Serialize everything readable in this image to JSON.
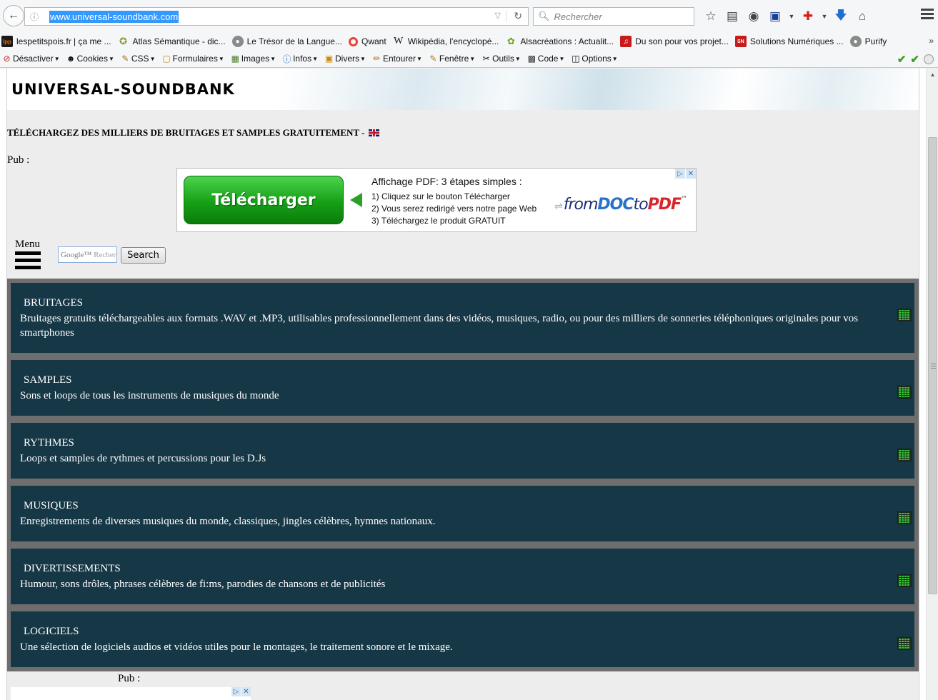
{
  "browser": {
    "url": "www.universal-soundbank.com",
    "search_placeholder": "Rechercher"
  },
  "bookmarks": [
    {
      "label": "lespetitspois.fr | ça me ...",
      "icon": "lpp-icon",
      "color": "#e36b00"
    },
    {
      "label": "Atlas Sémantique - dic...",
      "icon": "atlas-icon",
      "color": "#7a9a2a"
    },
    {
      "label": "Le Trésor de la Langue...",
      "icon": "globe-icon",
      "color": "#8a8a8a"
    },
    {
      "label": "Qwant",
      "icon": "qwant-icon",
      "color": "#e8433a"
    },
    {
      "label": "Wikipédia, l'encyclopé...",
      "icon": "wikipedia-icon",
      "color": "#ffffff"
    },
    {
      "label": "Alsacréations : Actualit...",
      "icon": "alsacreations-icon",
      "color": "#6ba51d"
    },
    {
      "label": "Du son pour vos projet...",
      "icon": "sound-icon",
      "color": "#c51b1b"
    },
    {
      "label": "Solutions Numériques ...",
      "icon": "sn-icon",
      "color": "#c81b1b"
    },
    {
      "label": "Purify",
      "icon": "globe-icon",
      "color": "#8a8a8a"
    }
  ],
  "devbar": [
    {
      "label": "Désactiver",
      "icon": "disable-icon"
    },
    {
      "label": "Cookies",
      "icon": "cookies-icon"
    },
    {
      "label": "CSS",
      "icon": "css-icon"
    },
    {
      "label": "Formulaires",
      "icon": "forms-icon"
    },
    {
      "label": "Images",
      "icon": "images-icon"
    },
    {
      "label": "Infos",
      "icon": "info-icon"
    },
    {
      "label": "Divers",
      "icon": "misc-icon"
    },
    {
      "label": "Entourer",
      "icon": "outline-icon"
    },
    {
      "label": "Fenêtre",
      "icon": "window-icon"
    },
    {
      "label": "Outils",
      "icon": "tools-icon"
    },
    {
      "label": "Code",
      "icon": "code-icon"
    },
    {
      "label": "Options",
      "icon": "options-icon"
    }
  ],
  "site": {
    "title": "UNIVERSAL-SOUNDBANK",
    "tagline": "TÉLÉCHARGEZ DES MILLIERS DE BRUITAGES ET SAMPLES GRATUITEMENT -",
    "pub_label": "Pub :",
    "menu_label": "Menu",
    "google_placeholder": "Rechercher",
    "google_brand": "Google™",
    "search_button": "Search"
  },
  "ad": {
    "button": "Télécharger",
    "title": "Affichage PDF: 3 étapes simples :",
    "steps": [
      "1) Cliquez sur le bouton Télécharger",
      "2) Vous serez redirigé vers notre page Web",
      "3) Téléchargez le produit GRATUIT"
    ],
    "logo_from": "from",
    "logo_doc": "DOC",
    "logo_to": "to",
    "logo_pdf": "PDF",
    "logo_tm": "™"
  },
  "categories": [
    {
      "title": "BRUITAGES",
      "desc": "Bruitages gratuits téléchargeables aux formats .WAV et .MP3, utilisables professionnellement dans des vidéos, musiques, radio, ou pour des milliers de sonneries téléphoniques originales pour vos smartphones"
    },
    {
      "title": "SAMPLES",
      "desc": "Sons et loops de tous les instruments de musiques du monde"
    },
    {
      "title": "RYTHMES",
      "desc": "Loops et samples de rythmes et percussions pour les D.Js"
    },
    {
      "title": "MUSIQUES",
      "desc": "Enregistrements de diverses musiques du monde, classiques, jingles célèbres, hymnes nationaux."
    },
    {
      "title": "DIVERTISSEMENTS",
      "desc": "Humour, sons drôles, phrases célèbres de fi:ms, parodies de chansons et de publicités"
    },
    {
      "title": "LOGICIELS",
      "desc": "Une sélection de logiciels audios et vidéos utiles pour le montages, le traitement sonore et le mixage."
    }
  ],
  "bottom_pub_label": "Pub :",
  "colors": {
    "category_bg": "#163746",
    "category_gap": "#6e6e6e",
    "accent_green": "#16a016"
  }
}
